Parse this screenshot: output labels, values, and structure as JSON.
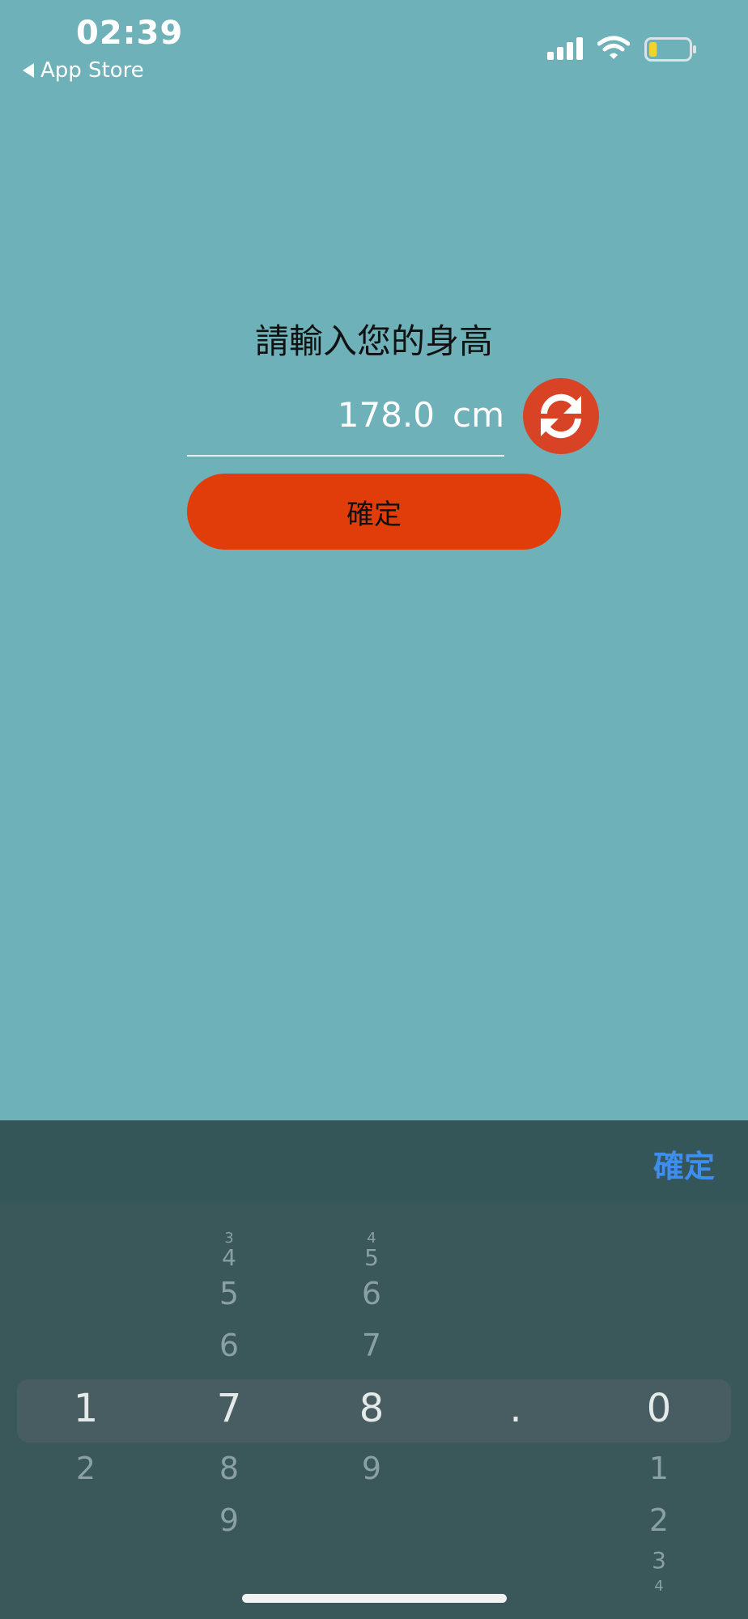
{
  "status_bar": {
    "time": "02:39",
    "back_label": "App Store",
    "battery_level": 0.2
  },
  "form": {
    "prompt": "請輸入您的身高",
    "height_value": "178.0",
    "height_unit": "cm",
    "confirm_label": "確定"
  },
  "picker_toolbar": {
    "confirm_label": "確定"
  },
  "picker": {
    "columns": [
      {
        "selected": "1",
        "above": [],
        "below": [
          "2"
        ]
      },
      {
        "selected": "7",
        "above": [
          "3",
          "4",
          "5",
          "6"
        ],
        "below": [
          "8",
          "9"
        ]
      },
      {
        "selected": "8",
        "above": [
          "4",
          "5",
          "6",
          "7"
        ],
        "below": [
          "9"
        ]
      },
      {
        "selected": ".",
        "above": [],
        "below": []
      },
      {
        "selected": "0",
        "above": [],
        "below": [
          "1",
          "2",
          "3",
          "4"
        ]
      }
    ]
  },
  "colors": {
    "background": "#6eb1b9",
    "accent": "#e03d0b",
    "refresh": "#d84325",
    "toolbar_action": "#3d8ef0"
  }
}
